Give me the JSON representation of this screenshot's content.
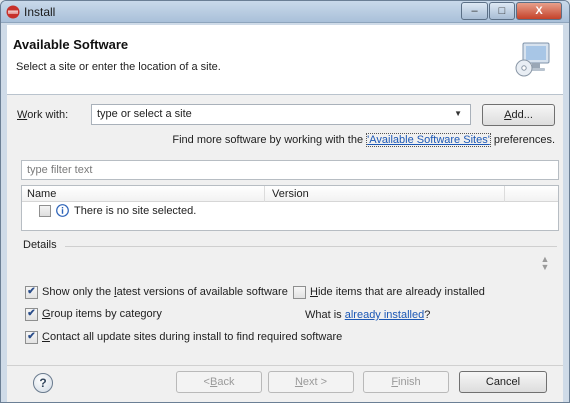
{
  "window": {
    "title": "Install"
  },
  "banner": {
    "title": "Available Software",
    "subtitle": "Select a site or enter the location of a site."
  },
  "work_with": {
    "label_mnemonic": "W",
    "label_rest": "ork with:",
    "value": "type or select a site",
    "add_label_mnemonic": "A",
    "add_label_rest": "dd...",
    "find_prefix": "Find more software by working with the ",
    "find_link": "'Available Software Sites'",
    "find_suffix": " preferences."
  },
  "filter": {
    "placeholder": "type filter text"
  },
  "table": {
    "columns": [
      "Name",
      "Version"
    ],
    "rows": [
      {
        "text": "There is no site selected.",
        "checked": false
      }
    ]
  },
  "details": {
    "label": "Details"
  },
  "options": {
    "latest": {
      "pre": "Show only the ",
      "m": "l",
      "post": "atest versions of available software",
      "checked": true
    },
    "hide": {
      "pre": "",
      "m": "H",
      "post": "ide items that are already installed",
      "checked": false
    },
    "group": {
      "pre": "",
      "m": "G",
      "post": "roup items by category",
      "checked": true
    },
    "what_is_prefix": "What is ",
    "what_is_link": "already installed",
    "what_is_suffix": "?",
    "contact": {
      "pre": "",
      "m": "C",
      "post": "ontact all update sites during install to find required software",
      "checked": true
    }
  },
  "footer": {
    "help": "?",
    "back": {
      "pre": "< ",
      "m": "B",
      "post": "ack"
    },
    "next": {
      "pre": "",
      "m": "N",
      "post": "ext >"
    },
    "finish": {
      "pre": "",
      "m": "F",
      "post": "inish"
    },
    "cancel": "Cancel"
  },
  "colors": {
    "link": "#1b57b5",
    "titlebar": "#a9c0d9",
    "close": "#c4422a"
  }
}
